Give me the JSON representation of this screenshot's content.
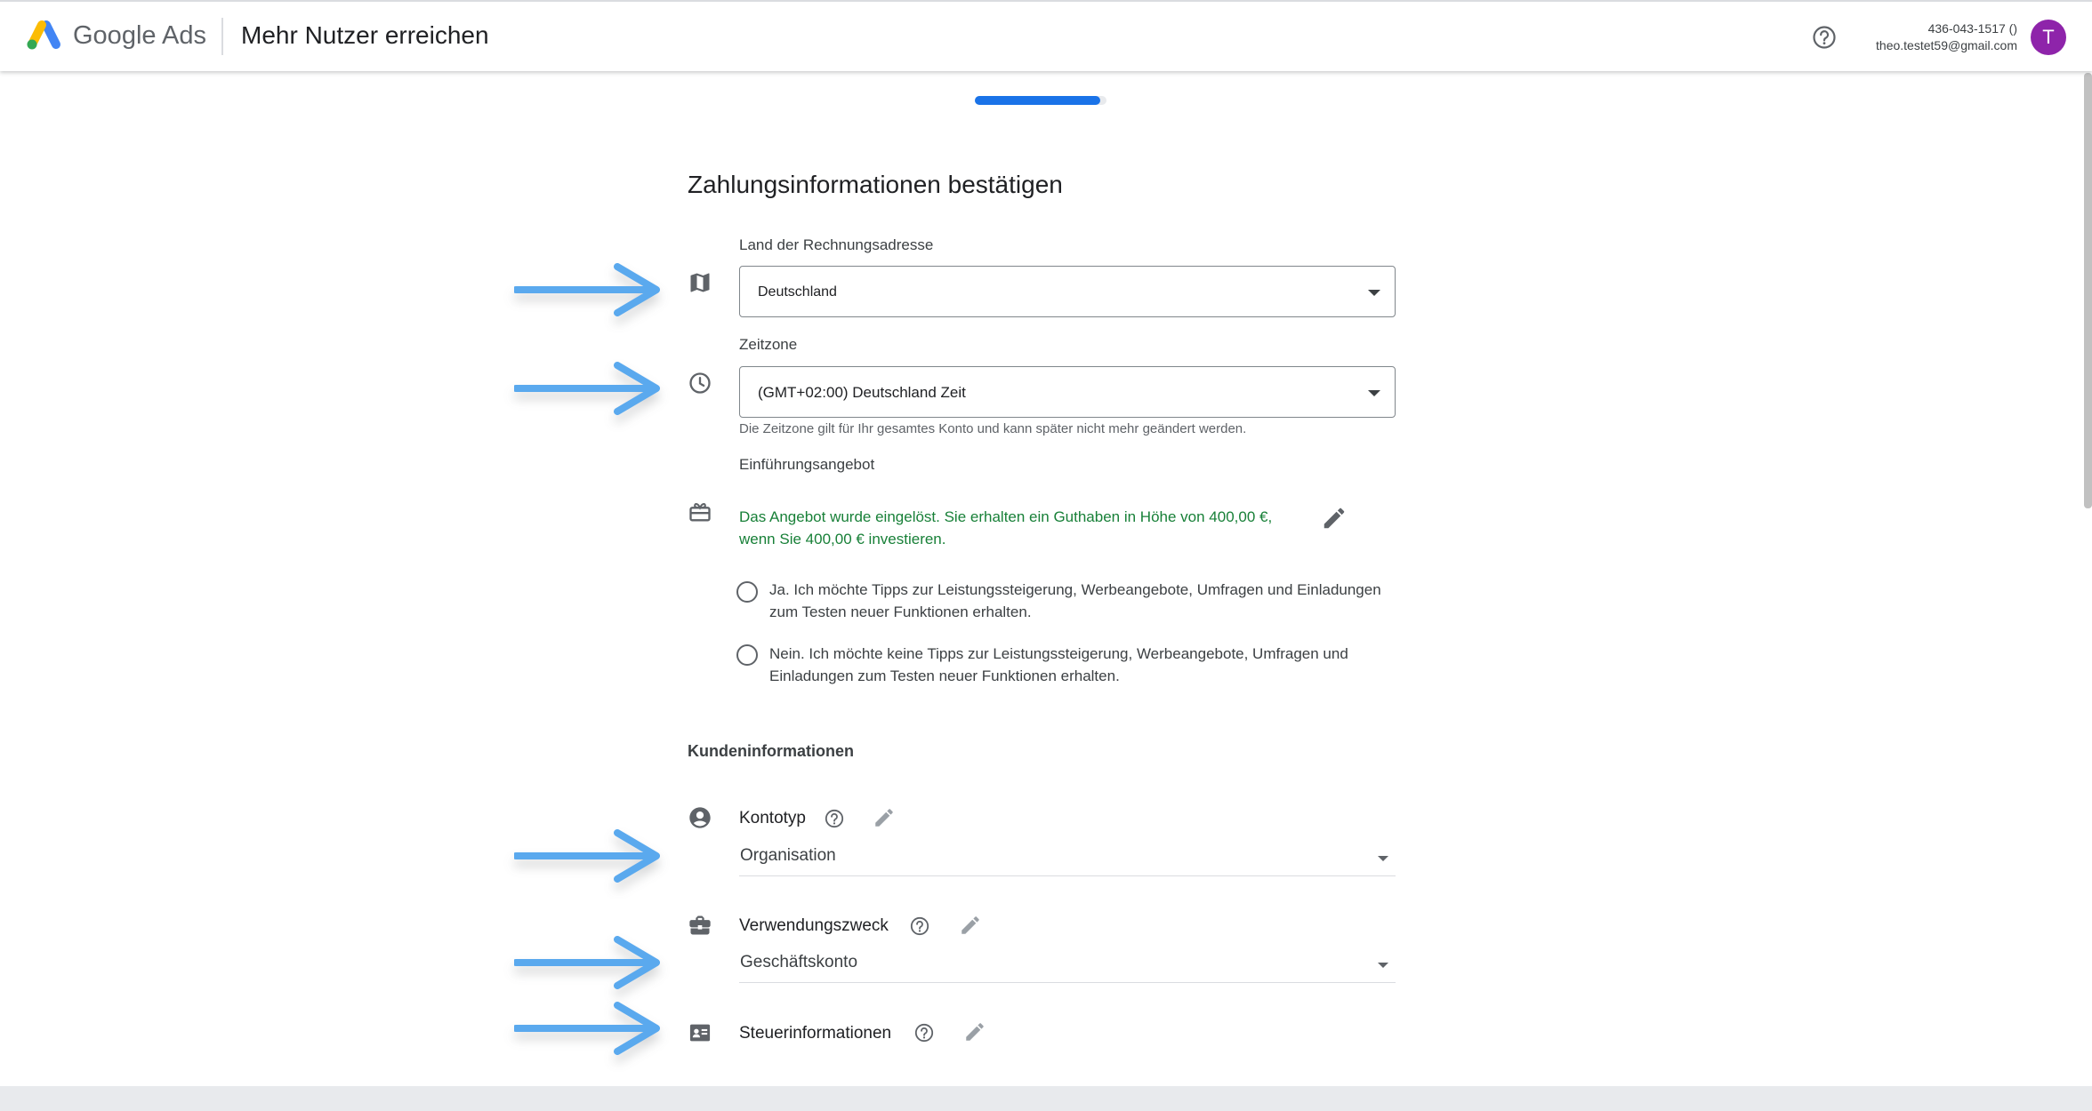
{
  "header": {
    "product_name": "Google Ads",
    "page_name": "Mehr Nutzer erreichen",
    "account_id": "436-043-1517 ()",
    "account_email": "theo.testet59@gmail.com",
    "avatar_letter": "T"
  },
  "progress": {
    "fraction": 0.95
  },
  "form": {
    "heading": "Zahlungsinformationen bestätigen",
    "country": {
      "label": "Land der Rechnungsadresse",
      "value": "Deutschland"
    },
    "timezone": {
      "label": "Zeitzone",
      "value": "(GMT+02:00) Deutschland Zeit",
      "hint": "Die Zeitzone gilt für Ihr gesamtes Konto und kann später nicht mehr geändert werden."
    },
    "offer": {
      "label": "Einführungsangebot",
      "text_line1": "Das Angebot wurde eingelöst. Sie erhalten ein Guthaben in Höhe von 400,00 €,",
      "text_line2": "wenn Sie 400,00 € investieren."
    },
    "tips_yes": {
      "line1": "Ja. Ich möchte Tipps zur Leistungssteigerung, Werbeangebote, Umfragen und Einladungen",
      "line2": "zum Testen neuer Funktionen erhalten."
    },
    "tips_no": {
      "line1": "Nein. Ich möchte keine Tipps zur Leistungssteigerung, Werbeangebote, Umfragen und",
      "line2": "Einladungen zum Testen neuer Funktionen erhalten."
    }
  },
  "customer": {
    "heading": "Kundeninformationen",
    "account_type": {
      "label": "Kontotyp",
      "value": "Organisation"
    },
    "purpose": {
      "label": "Verwendungszweck",
      "value": "Geschäftskonto"
    },
    "tax": {
      "label": "Steuerinformationen"
    }
  },
  "colors": {
    "brand_blue": "#1a73e8",
    "offer_green": "#188038",
    "avatar_purple": "#8e24aa",
    "annotation_arrow": "#5aa9ee"
  }
}
